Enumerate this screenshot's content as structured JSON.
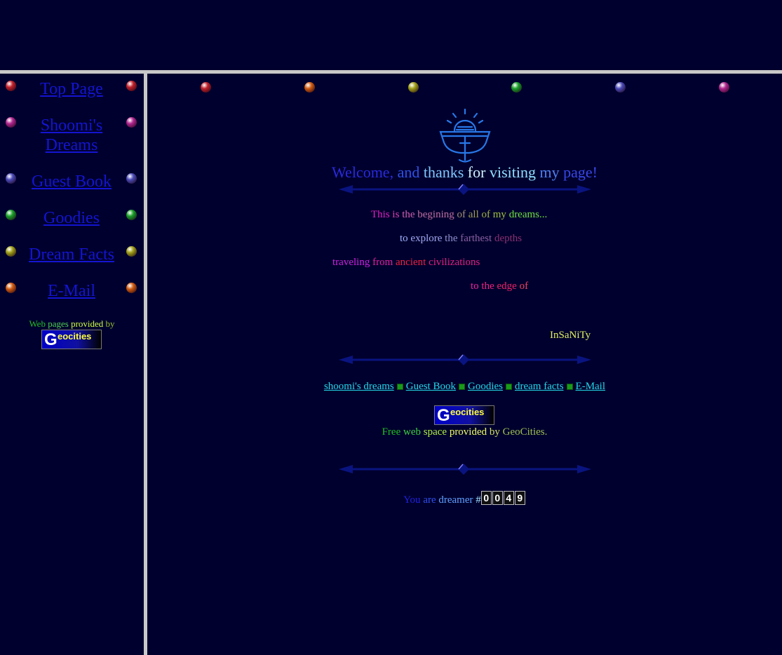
{
  "sidebar": {
    "nav": [
      {
        "label": "Top Page",
        "ball_color": "#c0202a"
      },
      {
        "label": "Shoomi's Dreams",
        "ball_color": "#b0258f"
      },
      {
        "label": "Guest Book",
        "ball_color": "#4a4ab8"
      },
      {
        "label": "Goodies",
        "ball_color": "#18a028"
      },
      {
        "label": "Dream Facts",
        "ball_color": "#a0a018"
      },
      {
        "label": "E-Mail",
        "ball_color": "#d05a10"
      }
    ],
    "caption_words": [
      {
        "text": "Web",
        "color": "#22c022"
      },
      {
        "text": "pages",
        "color": "#50d050"
      },
      {
        "text": "provided",
        "color": "#d0ff40"
      },
      {
        "text": "by",
        "color": "#9abf30"
      }
    ],
    "geocities_logo": {
      "g": "G",
      "rest": "eocities"
    }
  },
  "top_balls": [
    "#c0202a",
    "#d05a10",
    "#a0a018",
    "#18a028",
    "#4a4ab8",
    "#b0258f"
  ],
  "main": {
    "welcome_words": [
      {
        "text": "Welcome,",
        "color": "#2a2ae0"
      },
      {
        "text": "and",
        "color": "#3050e8"
      },
      {
        "text": "thanks",
        "color": "#80c8ff"
      },
      {
        "text": "for",
        "color": "#d0f4ff"
      },
      {
        "text": "visiting",
        "color": "#90e0ff"
      },
      {
        "text": "my",
        "color": "#5080f0"
      },
      {
        "text": "page!",
        "color": "#3848e8"
      }
    ],
    "dream_lines": [
      {
        "words": [
          {
            "text": "This",
            "color": "#e020c0"
          },
          {
            "text": "is",
            "color": "#e040b0"
          },
          {
            "text": "the",
            "color": "#d060b0"
          },
          {
            "text": "begining",
            "color": "#c070a0"
          },
          {
            "text": "of",
            "color": "#a09070"
          },
          {
            "text": "all",
            "color": "#a0a050"
          },
          {
            "text": "of",
            "color": "#a0b040"
          },
          {
            "text": "my",
            "color": "#a0c040"
          },
          {
            "text": "dreams...",
            "color": "#70e040"
          }
        ]
      },
      {
        "words": [
          {
            "text": "to",
            "color": "#a0b0ff"
          },
          {
            "text": "explore",
            "color": "#a0a8f0"
          },
          {
            "text": "the",
            "color": "#9090d0"
          },
          {
            "text": "farthest",
            "color": "#8a60a0"
          },
          {
            "text": "depths",
            "color": "#8a3070"
          }
        ]
      },
      {
        "words": [
          {
            "text": "traveling",
            "color": "#d020e0"
          },
          {
            "text": "from",
            "color": "#e020a0"
          },
          {
            "text": "ancient",
            "color": "#f02040"
          },
          {
            "text": "civilizations",
            "color": "#e02080"
          }
        ]
      },
      {
        "words": [
          {
            "text": "to",
            "color": "#f020a0"
          },
          {
            "text": "the",
            "color": "#f02080"
          },
          {
            "text": "edge",
            "color": "#f02068"
          },
          {
            "text": "of",
            "color": "#f04060"
          }
        ]
      },
      {
        "words": [
          {
            "text": "InSaNiTy",
            "color": "#e0f060"
          }
        ]
      }
    ],
    "bottom_nav": [
      {
        "label": "shoomi's dreams"
      },
      {
        "label": "Guest Book"
      },
      {
        "label": "Goodies"
      },
      {
        "label": "dream facts"
      },
      {
        "label": "E-Mail"
      }
    ],
    "geocities_logo": {
      "g": "G",
      "rest": "eocities"
    },
    "freeweb_words": [
      {
        "text": "Free",
        "color": "#20c020"
      },
      {
        "text": "web",
        "color": "#40d040"
      },
      {
        "text": "space",
        "color": "#b0f040"
      },
      {
        "text": "provided",
        "color": "#f0ff60"
      },
      {
        "text": "by",
        "color": "#d0e060"
      },
      {
        "text": "GeoCities.",
        "color": "#a0c050"
      }
    ],
    "counter": {
      "prefix_words": [
        {
          "text": "You",
          "color": "#2020e0"
        },
        {
          "text": "are",
          "color": "#3050f0"
        },
        {
          "text": "dreamer",
          "color": "#60a0ff"
        },
        {
          "text": "#",
          "color": "#a0e0ff"
        }
      ],
      "digits": [
        "0",
        "0",
        "4",
        "9"
      ]
    }
  }
}
